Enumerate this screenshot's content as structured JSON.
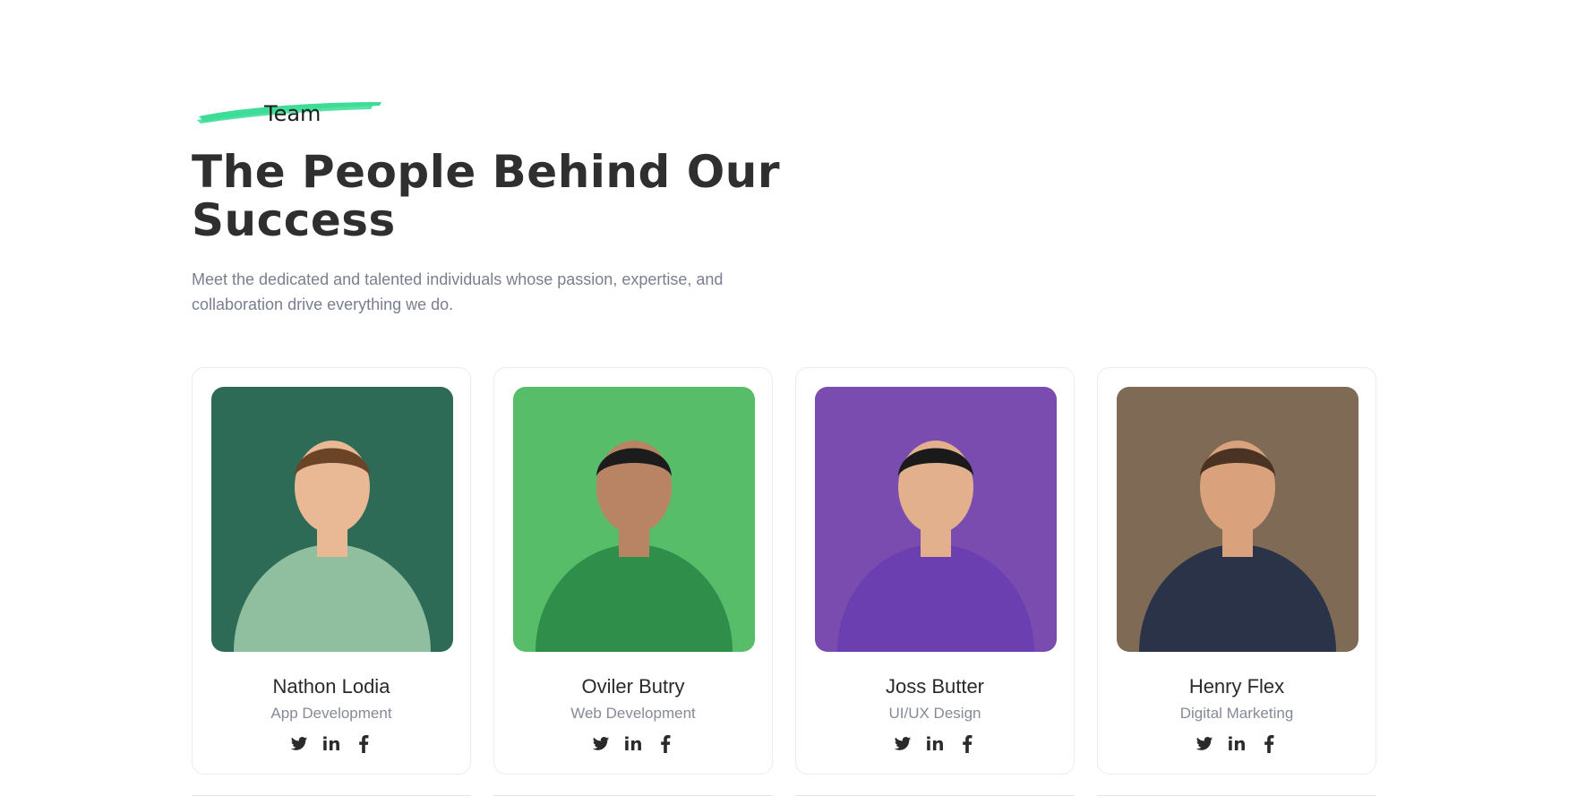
{
  "section": {
    "eyebrow": "Team",
    "heading": "The People Behind Our Success",
    "subtitle": "Meet the dedicated and talented individuals whose passion, expertise, and collaboration drive everything we do.",
    "accent_color": "#3ddc97"
  },
  "team": [
    {
      "name": "Nathon Lodia",
      "role": "App Development",
      "photo_bg": "#2e6b57",
      "shirt": "#8fbf9f",
      "skin": "#e8b994",
      "hair": "#6b4428"
    },
    {
      "name": "Oviler Butry",
      "role": "Web Development",
      "photo_bg": "#57bd68",
      "shirt": "#2f8f4a",
      "skin": "#b98464",
      "hair": "#1c1c1c"
    },
    {
      "name": "Joss Butter",
      "role": "UI/UX Design",
      "photo_bg": "#7b4cb0",
      "shirt": "#6b3fb0",
      "skin": "#e2b08c",
      "hair": "#1a1a1a"
    },
    {
      "name": "Henry Flex",
      "role": "Digital Marketing",
      "photo_bg": "#7f6b55",
      "shirt": "#2b3348",
      "skin": "#d9a27c",
      "hair": "#4a3322"
    }
  ],
  "socials": [
    {
      "icon": "twitter-icon"
    },
    {
      "icon": "linkedin-icon",
      "label": "in"
    },
    {
      "icon": "facebook-icon"
    }
  ]
}
